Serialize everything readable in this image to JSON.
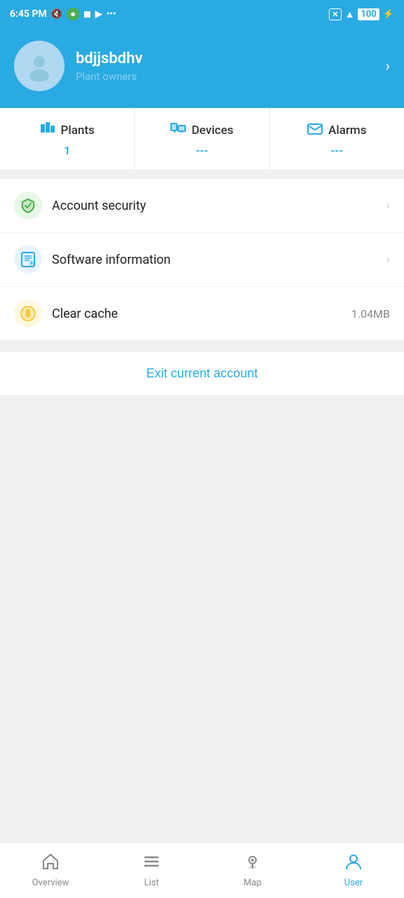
{
  "statusBar": {
    "time": "6:45 PM",
    "icons": [
      "muted",
      "app1",
      "app2",
      "app3",
      "more"
    ],
    "rightIcons": [
      "close",
      "wifi",
      "battery100",
      "charging"
    ]
  },
  "header": {
    "username": "bdjjsbdhv",
    "role": "Plant owners",
    "chevron": "›"
  },
  "stats": [
    {
      "label": "Plants",
      "icon": "≡",
      "value": "1"
    },
    {
      "label": "Devices",
      "icon": "⊞",
      "value": "---"
    },
    {
      "label": "Alarms",
      "icon": "✉",
      "value": "---"
    }
  ],
  "menuItems": [
    {
      "id": "account-security",
      "label": "Account security",
      "iconType": "security",
      "iconSymbol": "🛡",
      "hasChevron": true,
      "value": ""
    },
    {
      "id": "software-information",
      "label": "Software information",
      "iconType": "software",
      "iconSymbol": "📋",
      "hasChevron": true,
      "value": ""
    },
    {
      "id": "clear-cache",
      "label": "Clear cache",
      "iconType": "cache",
      "iconSymbol": "🗑",
      "hasChevron": false,
      "value": "1.04MB"
    }
  ],
  "exitButton": {
    "label": "Exit current account"
  },
  "bottomNav": [
    {
      "id": "overview",
      "label": "Overview",
      "icon": "home",
      "active": false
    },
    {
      "id": "list",
      "label": "List",
      "icon": "list",
      "active": false
    },
    {
      "id": "map",
      "label": "Map",
      "icon": "map",
      "active": false
    },
    {
      "id": "user",
      "label": "User",
      "icon": "user",
      "active": true
    }
  ],
  "colors": {
    "primary": "#29aae2",
    "securityBg": "#e8f8e8",
    "softwareBg": "#e8f4ff",
    "cacheBg": "#fff8e0"
  }
}
